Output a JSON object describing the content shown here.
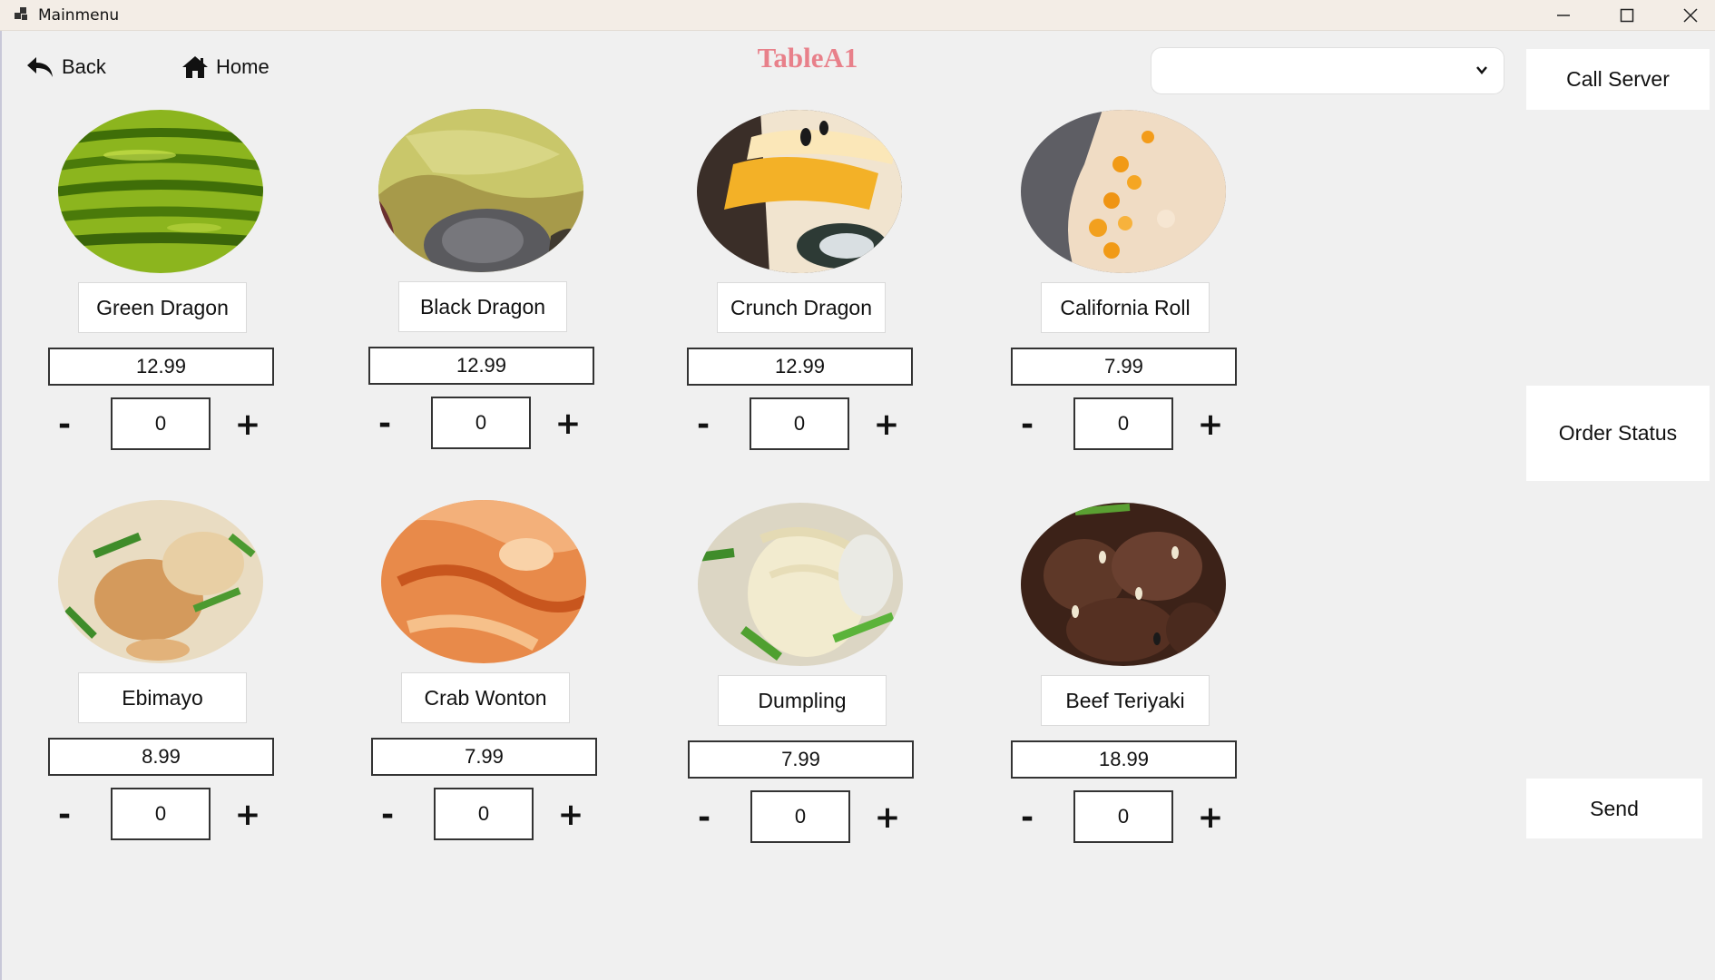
{
  "window": {
    "title": "Mainmenu"
  },
  "nav": {
    "back_label": "Back",
    "home_label": "Home"
  },
  "table_name": "TableA1",
  "table_select": {
    "value": ""
  },
  "actions": {
    "call_server": "Call Server",
    "order_status": "Order Status",
    "send": "Send"
  },
  "controls": {
    "minus": "-",
    "plus": "+"
  },
  "menu_items": [
    {
      "name": "Green Dragon",
      "price": "12.99",
      "quantity": "0"
    },
    {
      "name": "Black Dragon",
      "price": "12.99",
      "quantity": "0"
    },
    {
      "name": "Crunch Dragon",
      "price": "12.99",
      "quantity": "0"
    },
    {
      "name": "California Roll",
      "price": "7.99",
      "quantity": "0"
    },
    {
      "name": "Ebimayo",
      "price": "8.99",
      "quantity": "0"
    },
    {
      "name": "Crab Wonton",
      "price": "7.99",
      "quantity": "0"
    },
    {
      "name": "Dumpling",
      "price": "7.99",
      "quantity": "0"
    },
    {
      "name": "Beef Teriyaki",
      "price": "18.99",
      "quantity": "0"
    }
  ],
  "icons": {
    "app": "app-grid-icon",
    "back": "back-arrow-icon",
    "home": "home-icon",
    "dropdown": "chevron-down-icon",
    "minimize": "minimize-icon",
    "maximize": "maximize-icon",
    "close": "close-icon"
  },
  "colors": {
    "table_title": "#e8808a",
    "background": "#f0f0f0",
    "titlebar": "#f3ede6"
  }
}
